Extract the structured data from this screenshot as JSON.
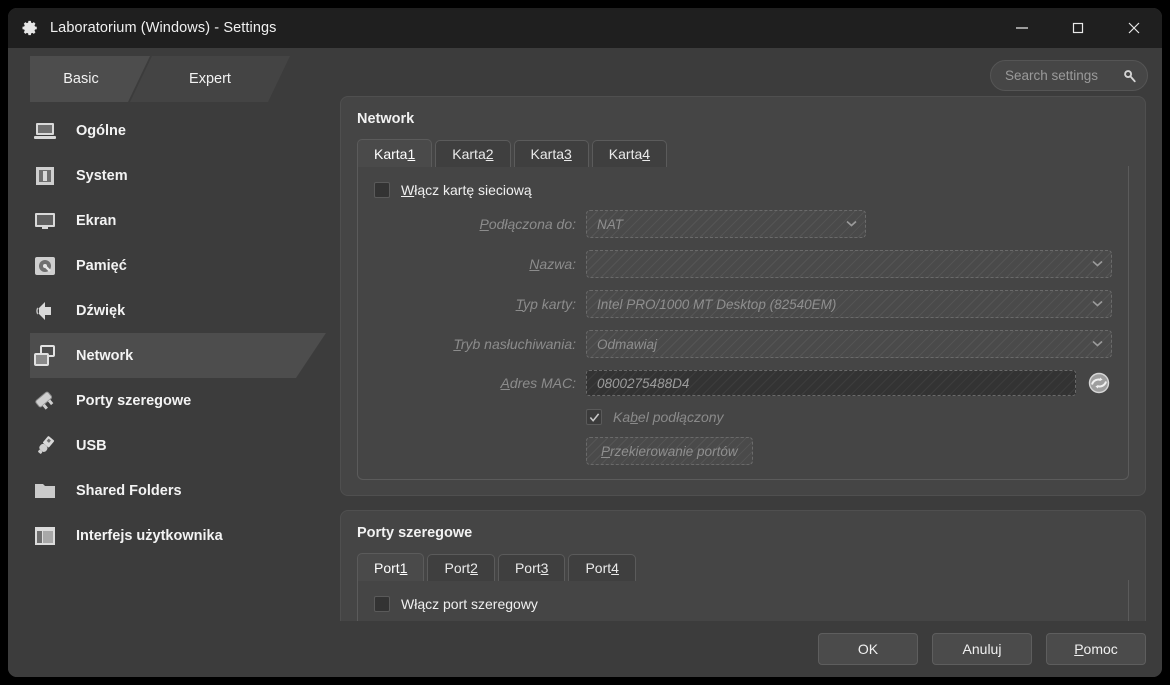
{
  "window": {
    "title": "Laboratorium (Windows) - Settings",
    "icon": "gear-icon",
    "controls": {
      "minimize": "minimize-icon",
      "maximize": "maximize-icon",
      "close": "close-icon"
    }
  },
  "modes": [
    {
      "label": "Basic",
      "selected": true
    },
    {
      "label": "Expert",
      "selected": false
    }
  ],
  "search": {
    "placeholder": "Search settings",
    "value": "",
    "icon": "search-icon"
  },
  "sidebar": {
    "items": [
      {
        "label": "Ogólne",
        "icon": "laptop-icon",
        "selected": false
      },
      {
        "label": "System",
        "icon": "chip-icon",
        "selected": false
      },
      {
        "label": "Ekran",
        "icon": "monitor-icon",
        "selected": false
      },
      {
        "label": "Pamięć",
        "icon": "harddisk-icon",
        "selected": false
      },
      {
        "label": "Dźwięk",
        "icon": "speaker-icon",
        "selected": false
      },
      {
        "label": "Network",
        "icon": "network-icon",
        "selected": true
      },
      {
        "label": "Porty szeregowe",
        "icon": "serial-port-icon",
        "selected": false
      },
      {
        "label": "USB",
        "icon": "usb-icon",
        "selected": false
      },
      {
        "label": "Shared Folders",
        "icon": "folder-icon",
        "selected": false
      },
      {
        "label": "Interfejs użytkownika",
        "icon": "window-layout-icon",
        "selected": false
      }
    ]
  },
  "network": {
    "title": "Network",
    "tabs": [
      {
        "prefix": "Karta ",
        "accel": "1",
        "active": true
      },
      {
        "prefix": "Karta ",
        "accel": "2",
        "active": false
      },
      {
        "prefix": "Karta ",
        "accel": "3",
        "active": false
      },
      {
        "prefix": "Karta ",
        "accel": "4",
        "active": false
      }
    ],
    "enable_checkbox": {
      "pre": "",
      "accel": "W",
      "post": "łącz kartę sieciową",
      "checked": false
    },
    "fields": [
      {
        "label_pre": "",
        "label_accel": "P",
        "label_post": "odłączona do:",
        "value": "NAT",
        "type": "combo",
        "width": "narrow"
      },
      {
        "label_pre": "",
        "label_accel": "N",
        "label_post": "azwa:",
        "value": "",
        "type": "combo",
        "width": "wide"
      },
      {
        "label_pre": "",
        "label_accel": "T",
        "label_post": "yp karty:",
        "value": "Intel PRO/1000 MT Desktop (82540EM)",
        "type": "combo",
        "width": "wide"
      },
      {
        "label_pre": "",
        "label_accel": "T",
        "label_post": "ryb nasłuchiwania:",
        "value": "Odmawiaj",
        "type": "combo",
        "width": "wide"
      }
    ],
    "mac": {
      "label_pre": "",
      "label_accel": "A",
      "label_post": "dres MAC:",
      "value": "0800275488D4",
      "refresh_icon": "refresh-mac-icon"
    },
    "cable_checkbox": {
      "pre": "Ka",
      "accel": "b",
      "post": "el podłączony",
      "checked": true
    },
    "port_forward_button": {
      "pre": "P",
      "accel": "P",
      "post": "rzekierowanie portów",
      "label": "Przekierowanie portów"
    }
  },
  "serial": {
    "title": "Porty szeregowe",
    "tabs": [
      {
        "prefix": "Port ",
        "accel": "1",
        "active": true
      },
      {
        "prefix": "Port ",
        "accel": "2",
        "active": false
      },
      {
        "prefix": "Port ",
        "accel": "3",
        "active": false
      },
      {
        "prefix": "Port ",
        "accel": "4",
        "active": false
      }
    ],
    "enable_checkbox": {
      "pre": "W",
      "accel": "",
      "post": "łącz port szeregowy",
      "checked": false
    }
  },
  "footer": {
    "ok": "OK",
    "cancel": "Anuluj",
    "help_pre": "",
    "help_accel": "P",
    "help_post": "omoc"
  },
  "colors": {
    "window_bg": "#3c3c3c",
    "titlebar_bg": "#1f1f1f",
    "panel_bg": "#454545",
    "selected_bg": "#4d4d4d",
    "text": "#f0f0f0",
    "muted_text": "#8c8c8c"
  }
}
